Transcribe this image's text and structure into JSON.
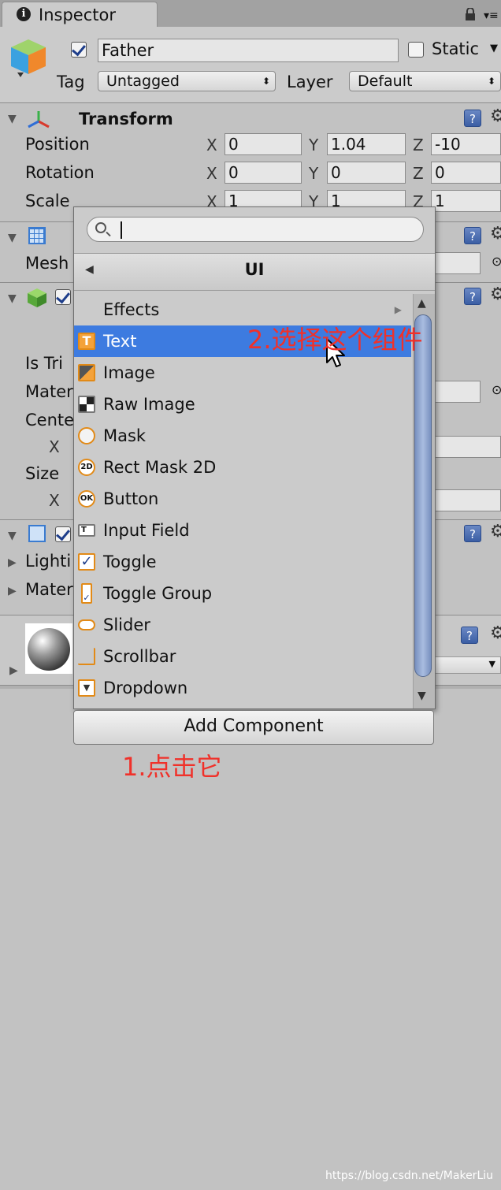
{
  "tab": {
    "title": "Inspector"
  },
  "header": {
    "name": "Father",
    "static_label": "Static",
    "tag_label": "Tag",
    "tag_value": "Untagged",
    "layer_label": "Layer",
    "layer_value": "Default"
  },
  "transform": {
    "title": "Transform",
    "position": {
      "label": "Position",
      "x": "0",
      "y": "1.04",
      "z": "-10"
    },
    "rotation": {
      "label": "Rotation",
      "x": "0",
      "y": "0",
      "z": "0"
    },
    "scale": {
      "label": "Scale",
      "x": "1",
      "y": "1",
      "z": "1"
    }
  },
  "axes": {
    "x": "X",
    "y": "Y",
    "z": "Z"
  },
  "partial_labels": {
    "mesh": "Mesh",
    "is_trigger": "Is Tri",
    "material": "Mater",
    "center": "Cente",
    "size": "Size",
    "x": "X",
    "lighting": "Lighti",
    "materials": "Mater"
  },
  "popup": {
    "search_value": "",
    "category": "UI",
    "items": [
      {
        "label": "Effects",
        "icon": "folder"
      },
      {
        "label": "Text",
        "icon": "text-icon"
      },
      {
        "label": "Image",
        "icon": "image-icon"
      },
      {
        "label": "Raw Image",
        "icon": "raw-image-icon"
      },
      {
        "label": "Mask",
        "icon": "mask-icon"
      },
      {
        "label": "Rect Mask 2D",
        "icon": "rect-mask-2d-icon"
      },
      {
        "label": "Button",
        "icon": "button-icon"
      },
      {
        "label": "Input Field",
        "icon": "input-field-icon"
      },
      {
        "label": "Toggle",
        "icon": "toggle-icon"
      },
      {
        "label": "Toggle Group",
        "icon": "toggle-group-icon"
      },
      {
        "label": "Slider",
        "icon": "slider-icon"
      },
      {
        "label": "Scrollbar",
        "icon": "scrollbar-icon"
      },
      {
        "label": "Dropdown",
        "icon": "dropdown-icon"
      }
    ],
    "selected": "Text",
    "icon_text": {
      "rect2d": "2D",
      "ok": "OK",
      "t": "T"
    }
  },
  "add_component_label": "Add Component",
  "annotations": {
    "step1": "1.点击它",
    "step2": "2.选择这个组件"
  },
  "watermark": "https://blog.csdn.net/MakerLiu",
  "colors": {
    "selection": "#3d7be0",
    "annotation": "#f0312a",
    "icon_accent": "#e28a17"
  }
}
